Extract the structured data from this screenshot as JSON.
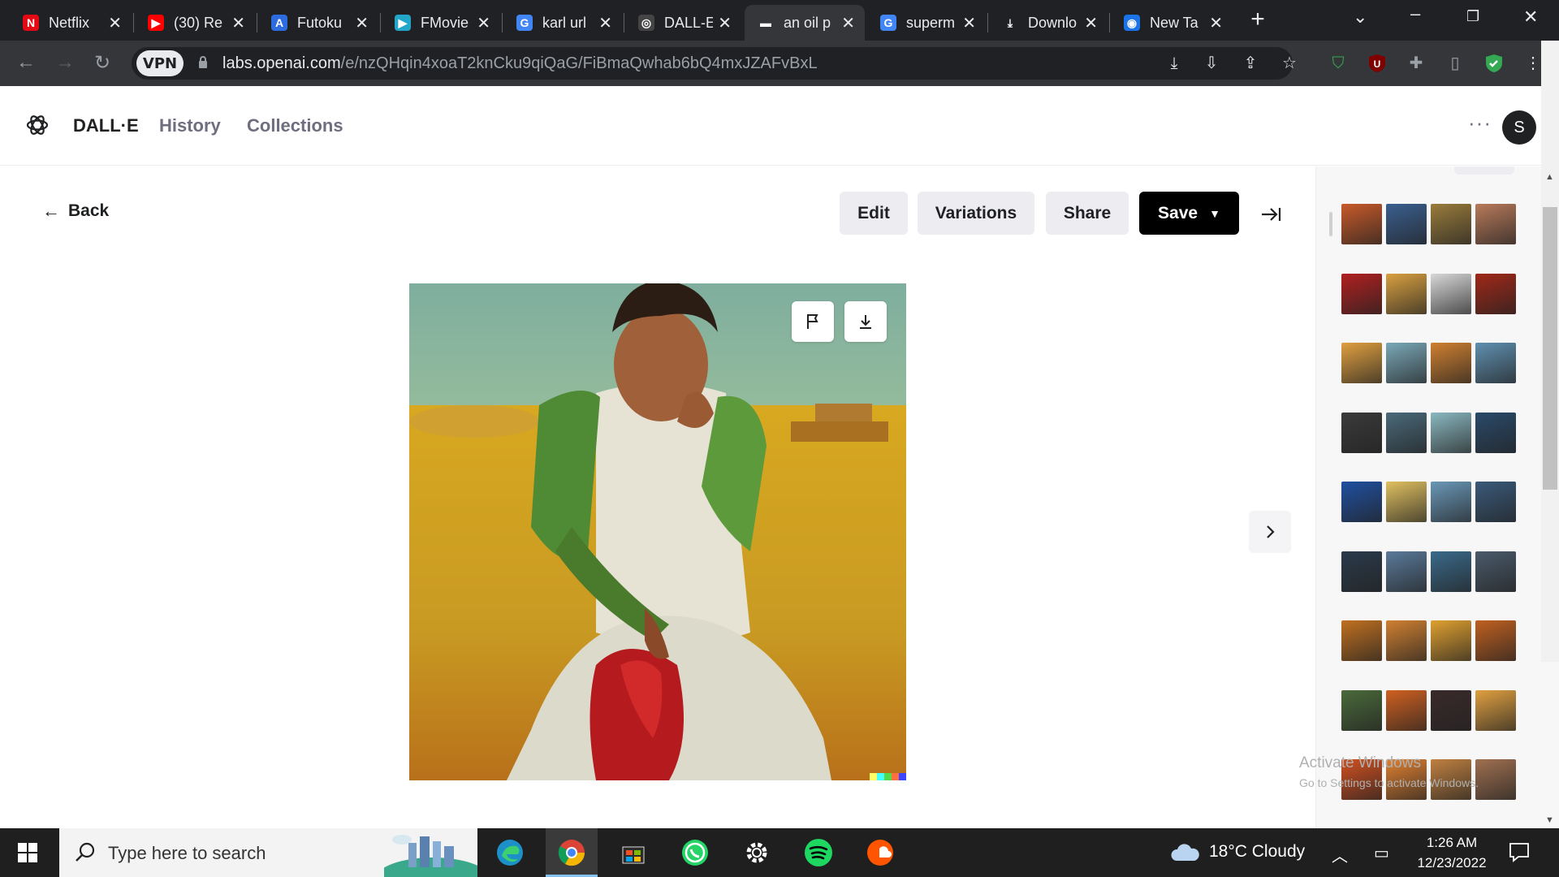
{
  "browser": {
    "tabs": [
      {
        "title": "Netflix",
        "icon": "netflix-icon",
        "color": "#e50914",
        "glyph": "N"
      },
      {
        "title": "(30) Re",
        "icon": "youtube-icon",
        "color": "#ff0000",
        "glyph": "▶"
      },
      {
        "title": "Futoku",
        "icon": "futoku-icon",
        "color": "#2d6cdf",
        "glyph": "A"
      },
      {
        "title": "FMovie",
        "icon": "fmovies-icon",
        "color": "#22a6c9",
        "glyph": "▶"
      },
      {
        "title": "karl url",
        "icon": "google-icon",
        "color": "#4285f4",
        "glyph": "G"
      },
      {
        "title": "DALL-E",
        "icon": "openai-icon",
        "color": "#444444",
        "glyph": "◎"
      },
      {
        "title": "an oil p",
        "icon": "dalle-icon",
        "color": "#35363a",
        "glyph": "▬",
        "active": true
      },
      {
        "title": "superm",
        "icon": "google-icon",
        "color": "#4285f4",
        "glyph": "G"
      },
      {
        "title": "Downlo",
        "icon": "download-icon",
        "color": "#202124",
        "glyph": "⤓"
      },
      {
        "title": "New Ta",
        "icon": "chrome-icon",
        "color": "#1a73e8",
        "glyph": "◉"
      }
    ],
    "new_tab": "+",
    "vpn_label": "VPN",
    "url_host": "labs.openai.com",
    "url_path": "/e/nzQHqin4xoaT2knCku9qiQaG/FiBmaQwhab6bQ4mxJZAFvBxL"
  },
  "app": {
    "brand": "DALL·E",
    "nav": [
      "History",
      "Collections"
    ],
    "more": "···",
    "avatar_initial": "S"
  },
  "toolbar": {
    "back": "Back",
    "edit": "Edit",
    "variations": "Variations",
    "share": "Share",
    "save": "Save"
  },
  "artwork": {
    "icons": [
      "flag-icon",
      "download-icon"
    ],
    "watermark_colors": [
      "#ffff66",
      "#42ffff",
      "#51da4c",
      "#ff6e3c",
      "#3c46ff"
    ]
  },
  "history": {
    "rows": [
      [
        "#c85a2a",
        "#3a5f8f",
        "#9a7c3c",
        "#b87a5a"
      ],
      [
        "#b02020",
        "#d8a040",
        "#d8d8d8",
        "#a02818"
      ],
      [
        "#e0a040",
        "#7aa8b8",
        "#d08030",
        "#6090b0"
      ],
      [
        "#3a3a3a",
        "#4a6a7a",
        "#8ab8c0",
        "#2a4a6a"
      ],
      [
        "#2050a0",
        "#e0c060",
        "#6a98b8",
        "#3a5a7a"
      ],
      [
        "#2a3a4a",
        "#5a7a9a",
        "#3a6a8a",
        "#4a5a6a"
      ],
      [
        "#c07020",
        "#d08030",
        "#e0a030",
        "#c06020"
      ],
      [
        "#4a6a3a",
        "#d06020",
        "#3a2a2a",
        "#e0a040"
      ],
      [
        "#d05020",
        "#e08030",
        "#c08040",
        "#a07050"
      ]
    ]
  },
  "windows_notice": {
    "title": "Activate Windows",
    "subtitle": "Go to Settings to activate Windows."
  },
  "taskbar": {
    "search_placeholder": "Type here to search",
    "weather": "18°C  Cloudy",
    "time": "1:26 AM",
    "date": "12/23/2022"
  }
}
